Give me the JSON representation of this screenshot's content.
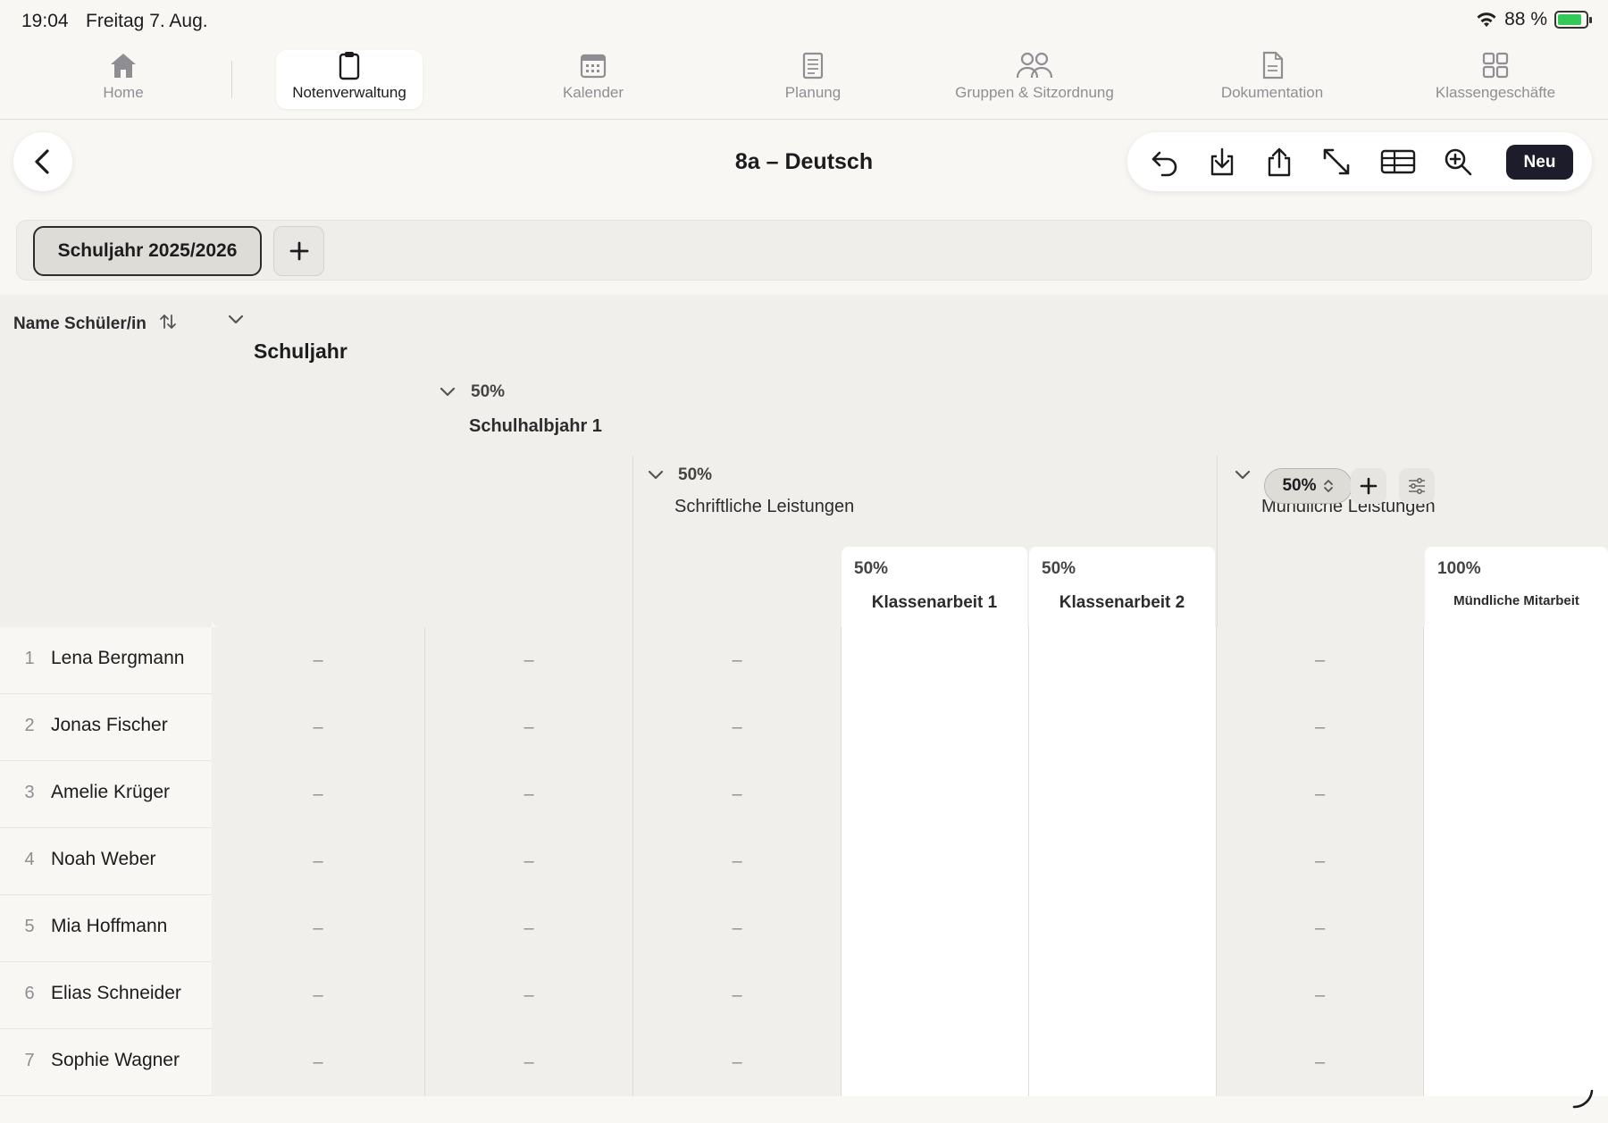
{
  "status": {
    "time": "19:04",
    "date": "Freitag 7. Aug.",
    "battery": "88 %",
    "battery_level": 0.88
  },
  "tabs": [
    {
      "label": "Home",
      "icon": "house-icon"
    },
    {
      "label": "Notenverwaltung",
      "icon": "clipboard-icon"
    },
    {
      "label": "Kalender",
      "icon": "calendar-icon"
    },
    {
      "label": "Planung",
      "icon": "notebook-icon"
    },
    {
      "label": "Gruppen & Sitzordnung",
      "icon": "people-icon"
    },
    {
      "label": "Dokumentation",
      "icon": "document-icon"
    },
    {
      "label": "Klassengeschäfte",
      "icon": "grid-icon"
    }
  ],
  "active_tab": "Notenverwaltung",
  "header": {
    "title": "8a – Deutsch",
    "new_label": "Neu"
  },
  "toolbar_icons": [
    "undo-icon",
    "download-icon",
    "share-icon",
    "expand-icon",
    "table-icon",
    "zoom-in-icon"
  ],
  "year": {
    "label": "Schuljahr 2025/2026"
  },
  "table": {
    "name_header": "Name Schüler/in",
    "levels": {
      "year": {
        "title": "Schuljahr"
      },
      "half": {
        "weight": "50%",
        "title": "Schulhalbjahr 1"
      },
      "written": {
        "weight": "50%",
        "title": "Schriftliche Leistungen"
      },
      "oral": {
        "weight": "50%",
        "title": "Mündliche Leistungen"
      },
      "exam1": {
        "weight": "50%",
        "title": "Klassenarbeit 1"
      },
      "exam2": {
        "weight": "50%",
        "title": "Klassenarbeit 2"
      },
      "participation": {
        "weight": "100%",
        "title": "Mündliche Mitarbeit"
      }
    },
    "empty_mark": "–",
    "students": [
      {
        "num": "1",
        "name": "Lena Bergmann"
      },
      {
        "num": "2",
        "name": "Jonas Fischer"
      },
      {
        "num": "3",
        "name": "Amelie Krüger"
      },
      {
        "num": "4",
        "name": "Noah Weber"
      },
      {
        "num": "5",
        "name": "Mia Hoffmann"
      },
      {
        "num": "6",
        "name": "Elias Schneider"
      },
      {
        "num": "7",
        "name": "Sophie Wagner"
      }
    ]
  }
}
